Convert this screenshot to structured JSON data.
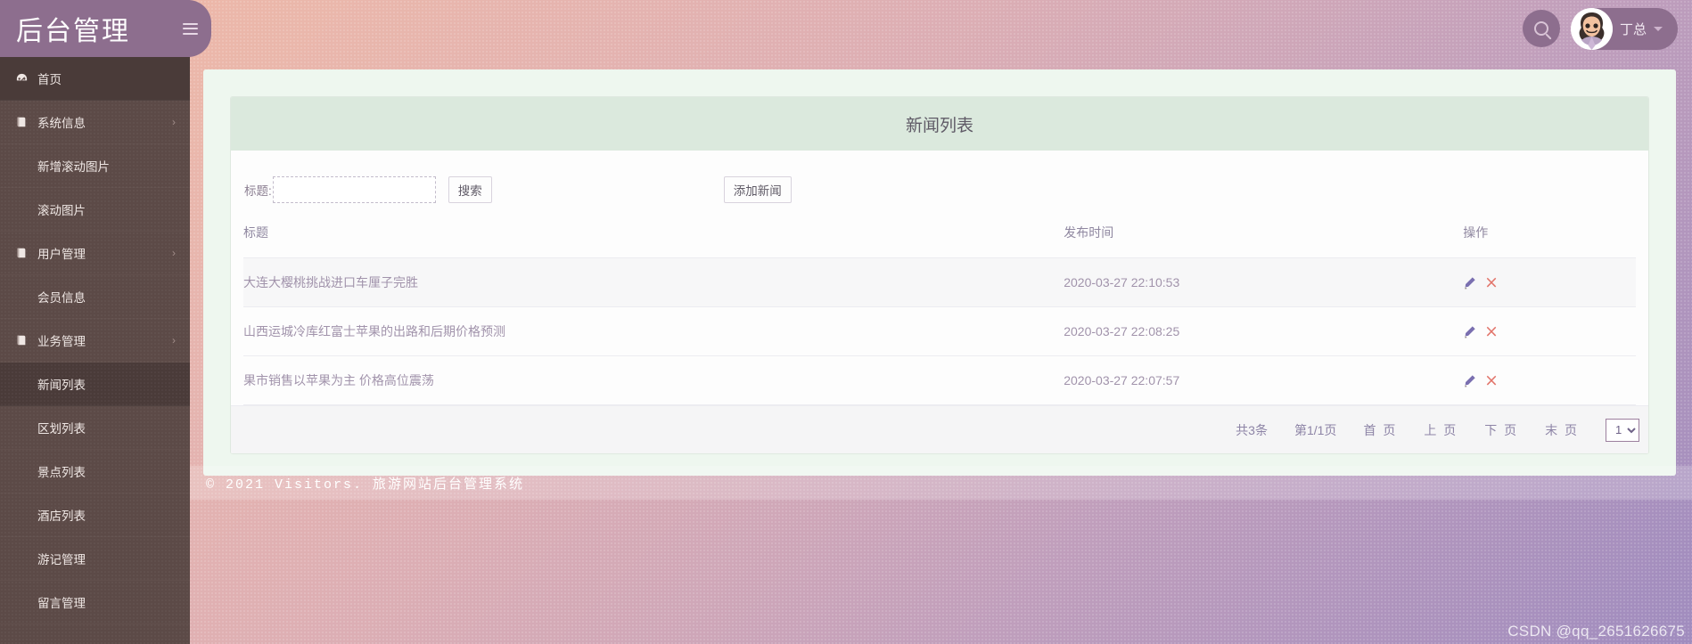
{
  "header": {
    "brand_title": "后台管理",
    "menu_toggle_icon": "hamburger-icon",
    "search_icon": "search-icon",
    "user_name": "丁总",
    "caret_icon": "chevron-down-icon"
  },
  "sidebar": {
    "items": [
      {
        "label": "首页",
        "type": "top",
        "icon": "dashboard-icon",
        "active": true,
        "expandable": false
      },
      {
        "label": "系统信息",
        "type": "top",
        "icon": "book-icon",
        "active": false,
        "expandable": true
      },
      {
        "label": "新增滚动图片",
        "type": "sub",
        "active": false
      },
      {
        "label": "滚动图片",
        "type": "sub",
        "active": false
      },
      {
        "label": "用户管理",
        "type": "top",
        "icon": "book-icon",
        "active": false,
        "expandable": true
      },
      {
        "label": "会员信息",
        "type": "sub",
        "active": false
      },
      {
        "label": "业务管理",
        "type": "top",
        "icon": "book-icon",
        "active": false,
        "expandable": true
      },
      {
        "label": "新闻列表",
        "type": "sub",
        "active": true
      },
      {
        "label": "区划列表",
        "type": "sub",
        "active": false
      },
      {
        "label": "景点列表",
        "type": "sub",
        "active": false
      },
      {
        "label": "酒店列表",
        "type": "sub",
        "active": false
      },
      {
        "label": "游记管理",
        "type": "sub",
        "active": false
      },
      {
        "label": "留言管理",
        "type": "sub",
        "active": false
      }
    ],
    "chevron_icon": "chevron-right-icon"
  },
  "main": {
    "card_title": "新闻列表",
    "search": {
      "label": "标题:",
      "value": "",
      "placeholder": "",
      "button_label": "搜索"
    },
    "add_button_label": "添加新闻",
    "table": {
      "columns": [
        "标题",
        "发布时间",
        "操作"
      ],
      "rows": [
        {
          "title": "大连大樱桃挑战进口车厘子完胜",
          "date": "2020-03-27 22:10:53",
          "hover": true
        },
        {
          "title": "山西运城冷库红富士苹果的出路和后期价格预测",
          "date": "2020-03-27 22:08:25",
          "hover": false
        },
        {
          "title": "果市销售以苹果为主 价格高位震荡",
          "date": "2020-03-27 22:07:57",
          "hover": false
        }
      ],
      "edit_icon": "pencil-icon",
      "delete_icon": "close-x-icon"
    },
    "pager": {
      "total_text": "共3条",
      "page_text": "第1/1页",
      "first_label": "首 页",
      "prev_label": "上 页",
      "next_label": "下 页",
      "last_label": "末 页",
      "selected_page": "1",
      "page_options": [
        "1"
      ]
    }
  },
  "footer": {
    "text": "© 2021 Visitors. 旅游网站后台管理系统"
  },
  "watermark": {
    "text": "CSDN @qq_2651626675"
  },
  "colors": {
    "brand_purple": "#8d6e8e",
    "sidebar_dark": "#5c4a47",
    "sidebar_active": "#4a3b39",
    "panel_green": "#eef7ef",
    "card_head_green": "#dbe9dd",
    "text_muted": "#a193ab",
    "edit_icon": "#7a6fb0",
    "delete_icon": "#e2756b"
  }
}
